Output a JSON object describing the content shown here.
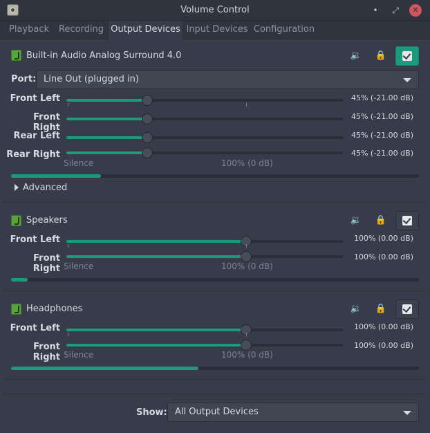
{
  "window": {
    "title": "Volume Control",
    "buttons": {
      "minimize": "•",
      "maximize": "⤢",
      "close": "✕"
    }
  },
  "tabs": [
    {
      "label": "Playback",
      "active": false
    },
    {
      "label": "Recording",
      "active": false
    },
    {
      "label": "Output Devices",
      "active": true
    },
    {
      "label": "Input Devices",
      "active": false
    },
    {
      "label": "Configuration",
      "active": false
    }
  ],
  "icons": {
    "speaker": "🔉",
    "lock": "🔒"
  },
  "scale": {
    "min_label": "Silence",
    "mid_label": "100% (0 dB)"
  },
  "devices": [
    {
      "name": "Built-in Audio Analog Surround 4.0",
      "default_checked": true,
      "port": {
        "label": "Port:",
        "value": "Line Out (plugged in)"
      },
      "channels": [
        {
          "label": "Front Left",
          "value_text": "45% (-21.00 dB)",
          "volume": 0.45
        },
        {
          "label": "Front Right",
          "value_text": "45% (-21.00 dB)",
          "volume": 0.45
        },
        {
          "label": "Rear Left",
          "value_text": "45% (-21.00 dB)",
          "volume": 0.45
        },
        {
          "label": "Rear Right",
          "value_text": "45% (-21.00 dB)",
          "volume": 0.45
        }
      ],
      "level": 0.22,
      "advanced_label": "Advanced"
    },
    {
      "name": "Speakers",
      "default_checked": false,
      "channels": [
        {
          "label": "Front Left",
          "value_text": "100% (0.00 dB)",
          "volume": 1.0
        },
        {
          "label": "Front Right",
          "value_text": "100% (0.00 dB)",
          "volume": 1.0
        }
      ],
      "level": 0.04
    },
    {
      "name": "Headphones",
      "default_checked": false,
      "channels": [
        {
          "label": "Front Left",
          "value_text": "100% (0.00 dB)",
          "volume": 1.0
        },
        {
          "label": "Front Right",
          "value_text": "100% (0.00 dB)",
          "volume": 1.0
        }
      ],
      "level": 0.46
    }
  ],
  "footer": {
    "show_label": "Show:",
    "show_value": "All Output Devices"
  }
}
